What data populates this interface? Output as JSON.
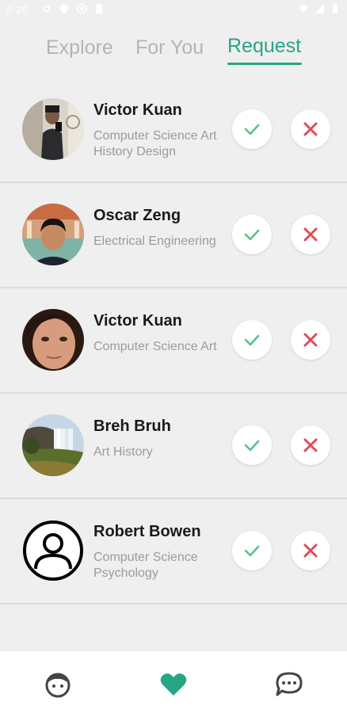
{
  "status_bar": {
    "time": "5:26"
  },
  "tabs": [
    {
      "label": "Explore",
      "active": false
    },
    {
      "label": "For You",
      "active": false
    },
    {
      "label": "Request",
      "active": true
    }
  ],
  "accent_color": "#26a687",
  "accept_color": "#5cc08b",
  "reject_color": "#e04a56",
  "requests": [
    {
      "name": "Victor Kuan",
      "major": "Computer Science Art History Design",
      "avatar": "photo-man-mirror-selfie"
    },
    {
      "name": "Oscar Zeng",
      "major": "Electrical Engineering",
      "avatar": "photo-man-smiling"
    },
    {
      "name": "Victor Kuan",
      "major": "Computer Science Art",
      "avatar": "photo-woman-face"
    },
    {
      "name": "Breh Bruh",
      "major": "Art History",
      "avatar": "photo-waterfall-landscape"
    },
    {
      "name": "Robert Bowen",
      "major": "Computer Science Psychology",
      "avatar": "default-user-icon"
    }
  ],
  "bottom_nav": [
    {
      "icon": "face-icon",
      "active": false
    },
    {
      "icon": "heart-icon",
      "active": true
    },
    {
      "icon": "chat-icon",
      "active": false
    }
  ]
}
